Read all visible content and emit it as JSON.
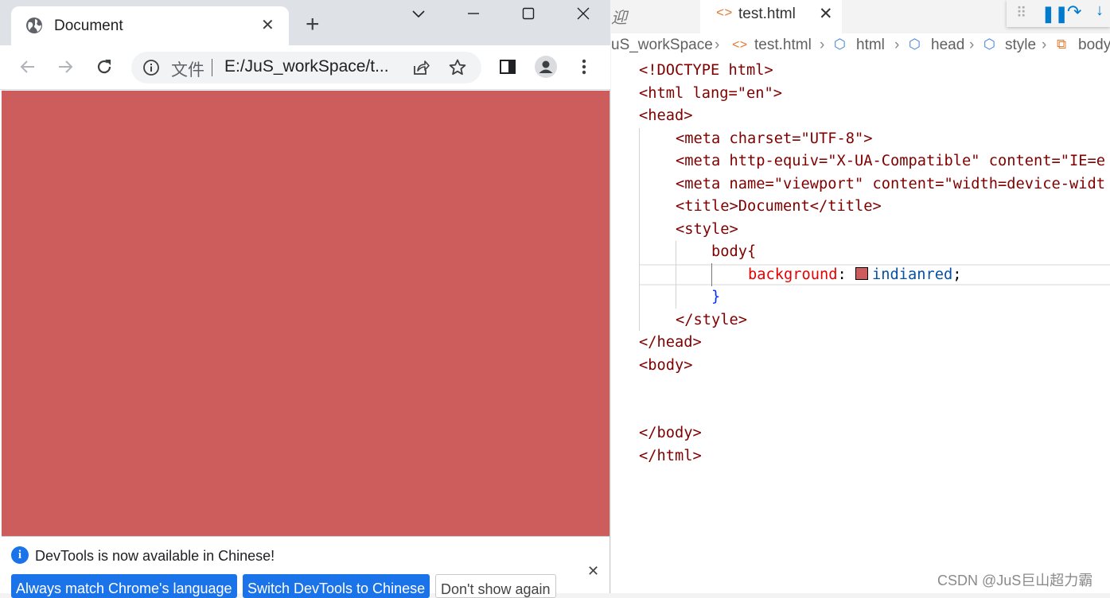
{
  "browser": {
    "tab": {
      "title": "Document"
    },
    "omnibox": {
      "scheme": "文件",
      "url": "E:/JuS_workSpace/t..."
    },
    "page": {
      "background": "#cd5c5c"
    },
    "devtools_banner": {
      "message": "DevTools is now available in Chinese!",
      "buttons": [
        {
          "label": "Always match Chrome's language"
        },
        {
          "label": "Switch DevTools to Chinese"
        },
        {
          "label": "Don't show again"
        }
      ]
    }
  },
  "editor": {
    "prev_tab_fragment": "迎",
    "active_tab": {
      "name": "test.html"
    },
    "breadcrumbs": [
      "uS_workSpace",
      "test.html",
      "html",
      "head",
      "style",
      "body"
    ],
    "code_lines": [
      "<!DOCTYPE html>",
      "<html lang=\"en\">",
      "<head>",
      "<meta charset=\"UTF-8\">",
      "<meta http-equiv=\"X-UA-Compatible\" content=\"IE=e",
      "<meta name=\"viewport\" content=\"width=device-widt",
      "<title>Document</title>",
      "<style>",
      "body{",
      "background: indianred;",
      "}",
      "</style>",
      "</head>",
      "<body>",
      "",
      "",
      "</body>",
      "</html>"
    ]
  },
  "watermark": "CSDN @JuS巨山超力霸"
}
